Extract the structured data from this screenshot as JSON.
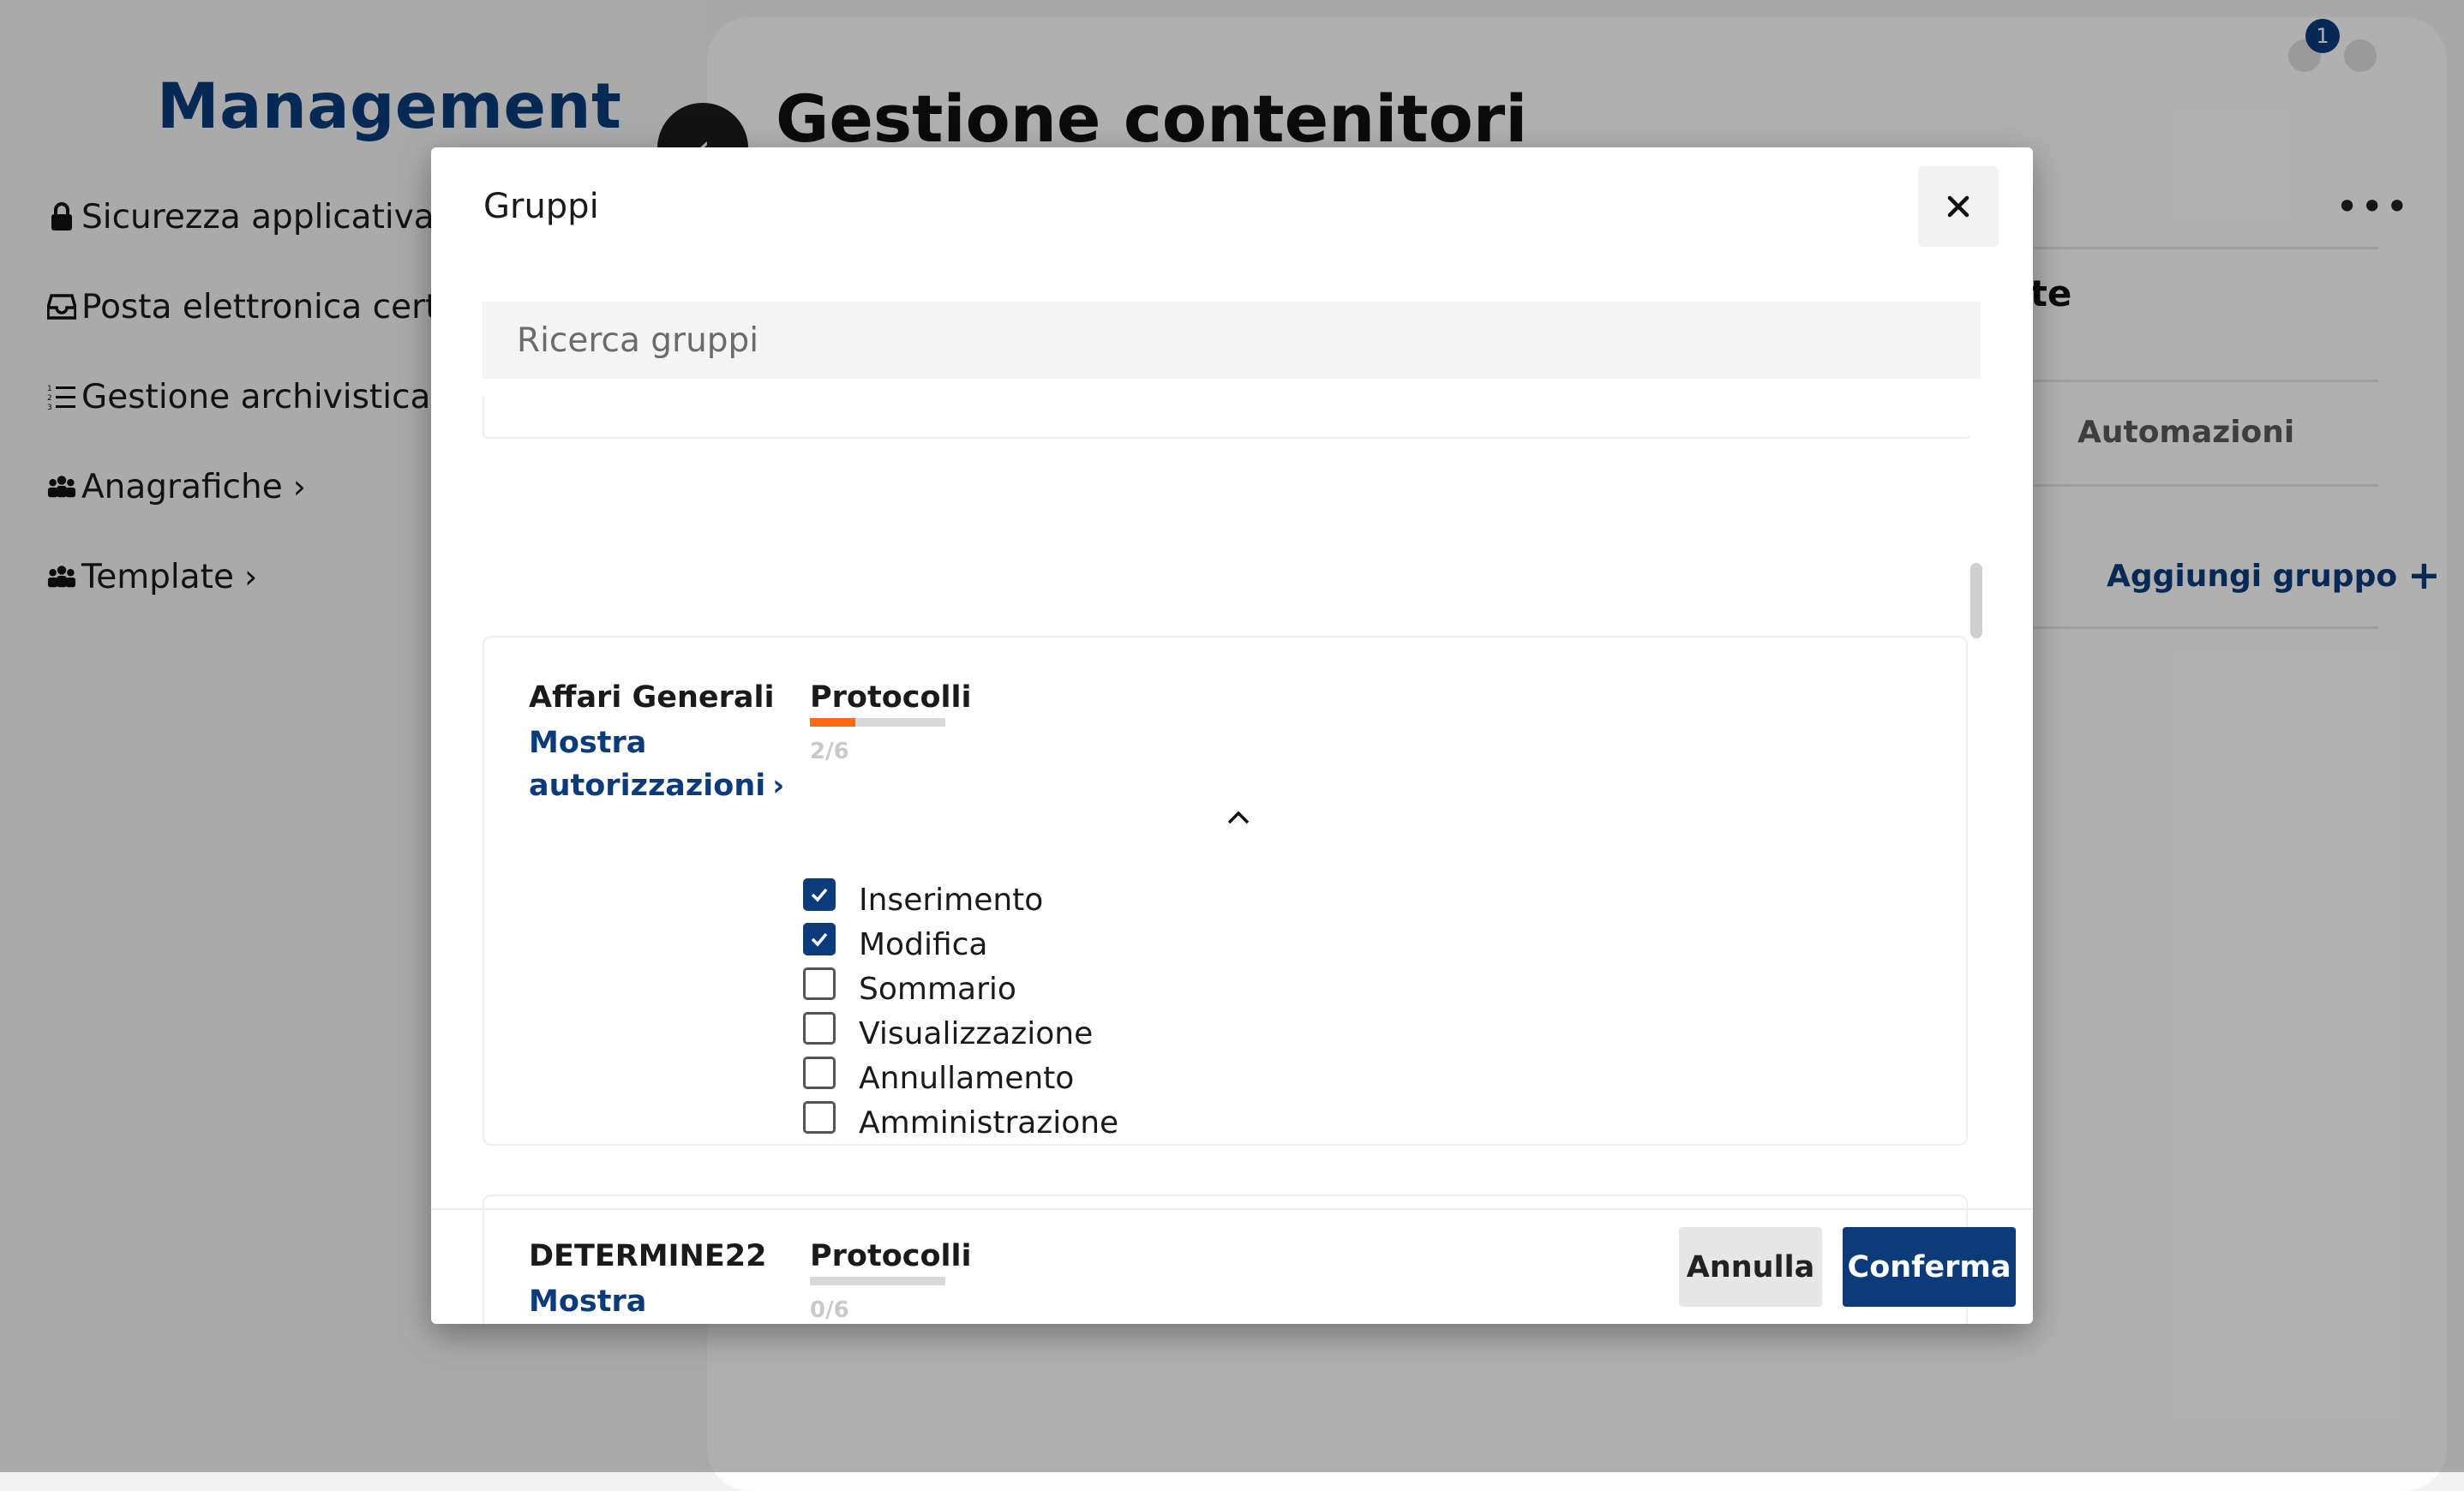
{
  "sidebar": {
    "title": "Management",
    "items": [
      {
        "label": "Sicurezza applicativa",
        "icon": "lock-icon"
      },
      {
        "label": "Posta elettronica certificata",
        "icon": "inbox-icon"
      },
      {
        "label": "Gestione archivistica",
        "icon": "numbered-list-icon"
      },
      {
        "label": "Anagrafiche",
        "icon": "people-icon"
      },
      {
        "label": "Template",
        "icon": "people-icon"
      }
    ]
  },
  "page": {
    "title": "Gestione contenitori",
    "notifications_count": "1",
    "partial_heading": "ote",
    "tab_automazioni": "Automazioni",
    "add_group_label": "Aggiungi gruppo"
  },
  "modal": {
    "title": "Gruppi",
    "search_placeholder": "Ricerca gruppi",
    "groups": [
      {
        "name": "Affari Generali",
        "show_auth_label": "Mostra autorizzazioni",
        "permission_category": "Protocolli",
        "progress": {
          "checked": 2,
          "total": 6,
          "text": "2/6"
        },
        "expanded": true,
        "permissions": [
          {
            "label": "Inserimento",
            "checked": true
          },
          {
            "label": "Modifica",
            "checked": true
          },
          {
            "label": "Sommario",
            "checked": false
          },
          {
            "label": "Visualizzazione",
            "checked": false
          },
          {
            "label": "Annullamento",
            "checked": false
          },
          {
            "label": "Amministrazione",
            "checked": false
          }
        ]
      },
      {
        "name": "DETERMINE22",
        "show_auth_label": "Mostra autorizzazioni",
        "permission_category": "Protocolli",
        "progress": {
          "checked": 0,
          "total": 6,
          "text": "0/6"
        },
        "expanded": false
      }
    ],
    "cancel_label": "Annulla",
    "confirm_label": "Conferma"
  },
  "colors": {
    "brand": "#0b3b7a",
    "progress_accent": "#ff6a13",
    "overlay": "rgba(0,0,0,0.3)"
  }
}
